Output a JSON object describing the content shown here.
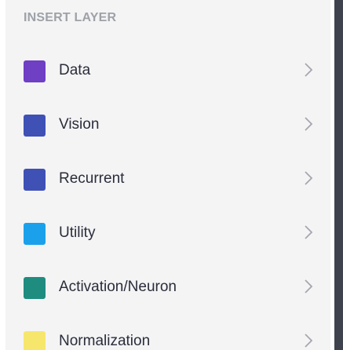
{
  "panel": {
    "heading": "INSERT LAYER",
    "items": [
      {
        "label": "Data",
        "color": "#6f3fc4",
        "icon": "chevron-right-icon"
      },
      {
        "label": "Vision",
        "color": "#3f51b5",
        "icon": "chevron-right-icon"
      },
      {
        "label": "Recurrent",
        "color": "#3f51b5",
        "icon": "chevron-right-icon"
      },
      {
        "label": "Utility",
        "color": "#1ba1ec",
        "icon": "chevron-right-icon"
      },
      {
        "label": "Activation/Neuron",
        "color": "#1f8c80",
        "icon": "chevron-right-icon"
      },
      {
        "label": "Normalization",
        "color": "#f6e76c",
        "icon": "chevron-right-icon"
      }
    ]
  }
}
